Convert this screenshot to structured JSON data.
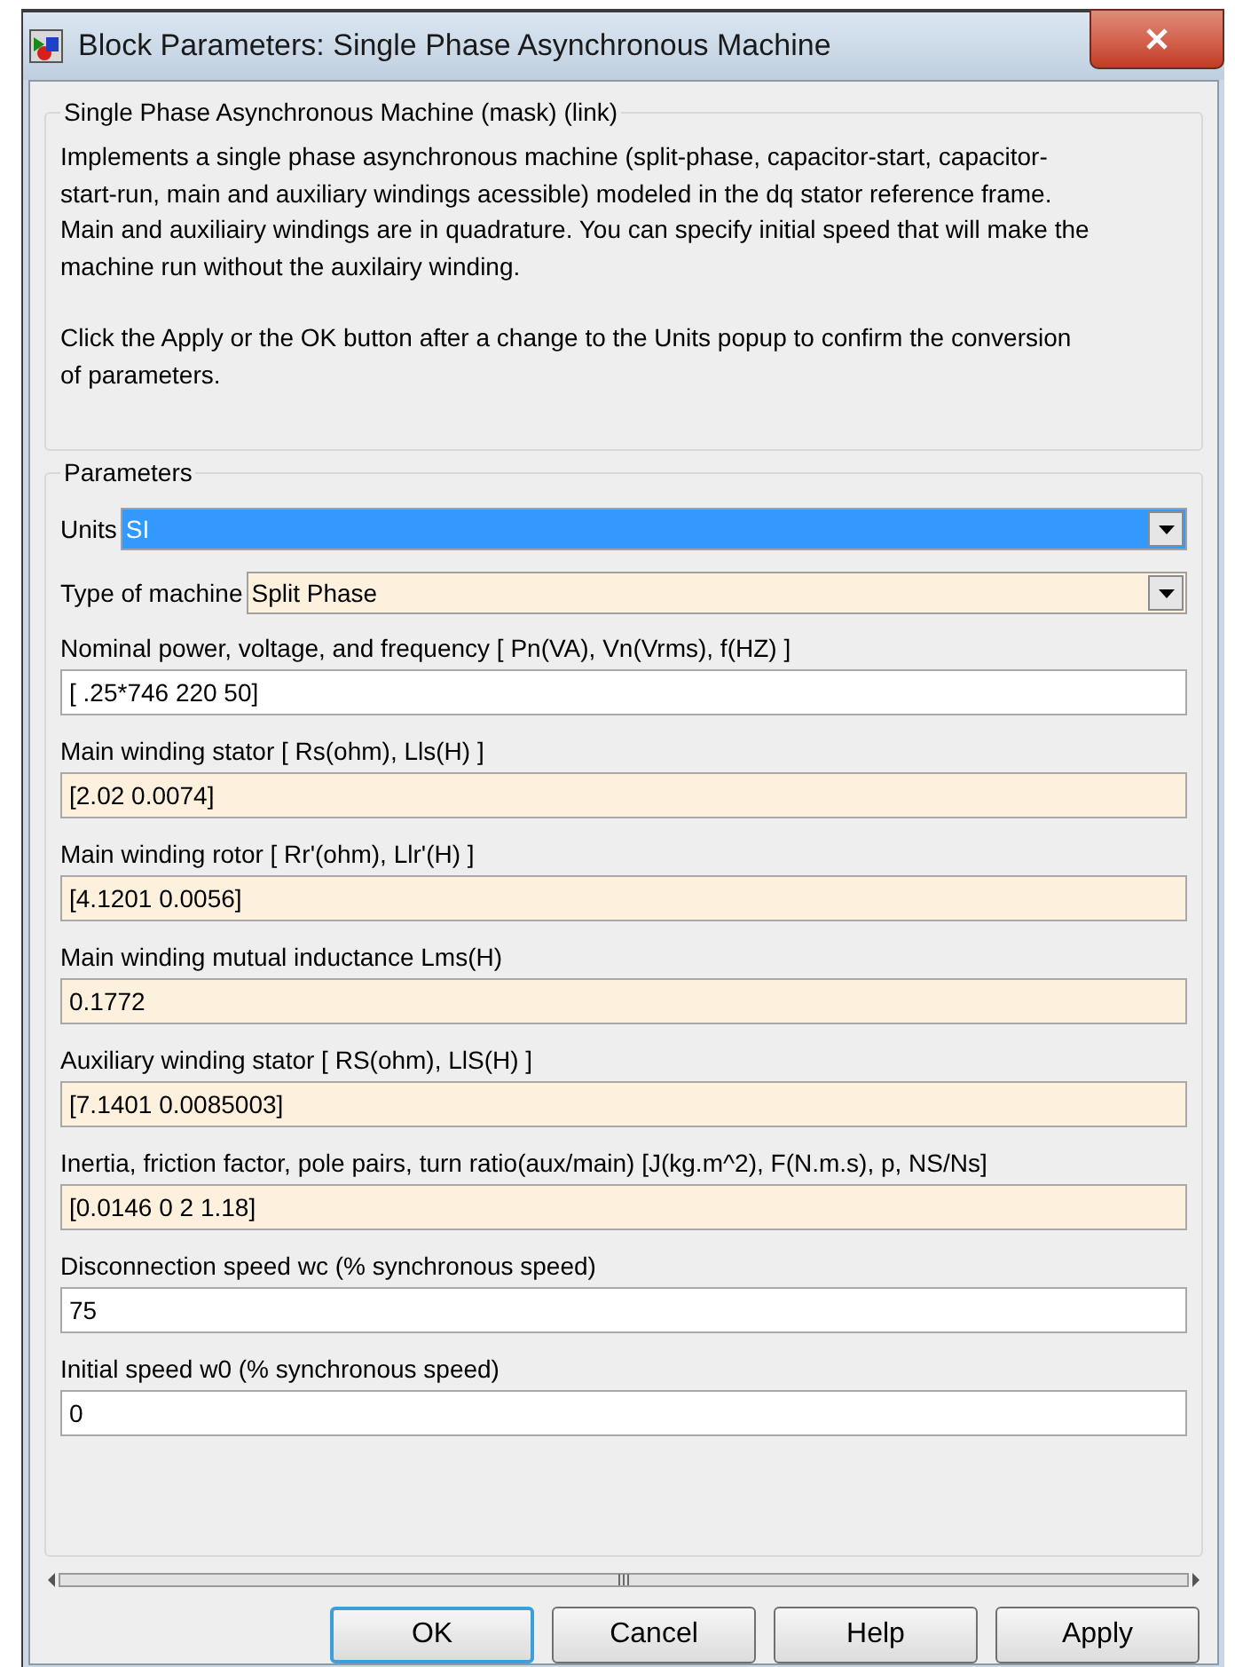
{
  "window": {
    "title": "Block Parameters: Single Phase Asynchronous Machine"
  },
  "description": {
    "title": "Single Phase Asynchronous Machine (mask) (link)",
    "paragraphs": [
      "Implements a single phase asynchronous machine (split-phase, capacitor-start, capacitor-start-run,  main and auxiliary windings acessible) modeled in the dq stator reference frame. Main and auxiliairy windings are in quadrature. You can specify initial speed that will make the machine run without the auxilairy winding.",
      "Click the Apply or the OK button after a change to the Units popup to confirm the conversion of parameters."
    ]
  },
  "parameters": {
    "title": "Parameters",
    "fields": [
      {
        "kind": "dropdown",
        "label": "Units",
        "value": "SI",
        "selected": true
      },
      {
        "kind": "dropdown",
        "label": "Type of machine",
        "value": "Split Phase",
        "selected": false,
        "color": "#fdf1de"
      },
      {
        "kind": "edit",
        "label": "Nominal power, voltage, and frequency [ Pn(VA), Vn(Vrms), f(HZ) ]",
        "value": "[ .25*746 220  50]",
        "color": "#ffffff"
      },
      {
        "kind": "edit",
        "label": "Main winding stator [ Rs(ohm), Lls(H) ]",
        "value": "[2.02 0.0074]",
        "color": "#fdf1de"
      },
      {
        "kind": "edit",
        "label": "Main winding rotor [ Rr'(ohm), Llr'(H) ]",
        "value": "[4.1201 0.0056]",
        "color": "#fdf1de"
      },
      {
        "kind": "edit",
        "label": "Main winding mutual inductance Lms(H)",
        "value": "0.1772",
        "color": "#fdf1de"
      },
      {
        "kind": "edit",
        "label": "Auxiliary  winding stator [ RS(ohm), LlS(H) ]",
        "value": "[7.1401 0.0085003]",
        "color": "#fdf1de"
      },
      {
        "kind": "edit",
        "label": "Inertia, friction factor, pole pairs, turn ratio(aux/main) [J(kg.m^2), F(N.m.s), p, NS/Ns]",
        "value": "[0.0146 0 2 1.18]",
        "color": "#fdf1de"
      },
      {
        "kind": "edit",
        "label": "Disconnection speed wc (% synchronous speed)",
        "value": "75",
        "color": "#ffffff"
      },
      {
        "kind": "edit",
        "label": "Initial speed w0 (% synchronous speed)",
        "value": "0",
        "color": "#ffffff"
      }
    ]
  },
  "scrollbar_grip": "III",
  "buttons": [
    {
      "label": "OK",
      "selected": true
    },
    {
      "label": "Cancel",
      "selected": false
    },
    {
      "label": "Help",
      "selected": false
    },
    {
      "label": "Apply",
      "selected": false
    }
  ]
}
